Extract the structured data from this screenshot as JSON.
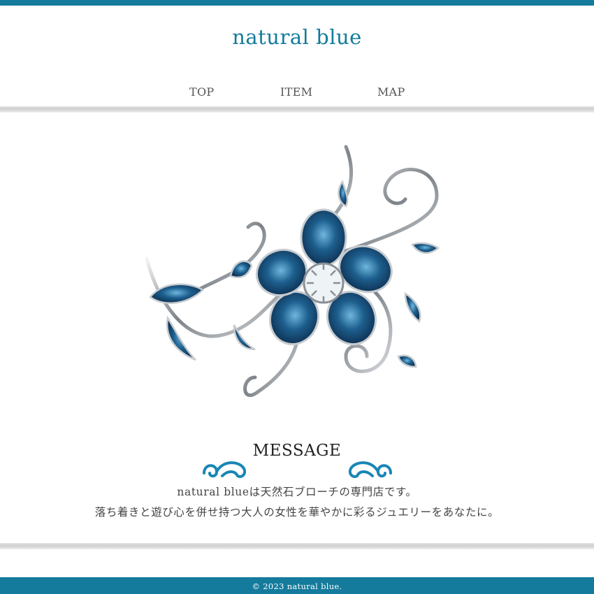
{
  "header": {
    "site_title": "natural blue",
    "nav": [
      {
        "label": "TOP"
      },
      {
        "label": "ITEM"
      },
      {
        "label": "MAP"
      }
    ]
  },
  "hero": {
    "image_subject": "silver-and-blue-floral-ornament"
  },
  "message": {
    "title": "MESSAGE",
    "lines": [
      "natural blueは天然石ブローチの専門店です。",
      "落ち着きと遊び心を併せ持つ大人の女性を華やかに彩るジュエリーをあなたに。"
    ],
    "ornament_icon": "flourish-swirl-icon"
  },
  "footer": {
    "copyright": "© 2023 natural blue."
  },
  "colors": {
    "brand": "#147b9c",
    "ornament_blue": "#1a86b5",
    "silver": "#8a8f96",
    "text": "#444444"
  }
}
